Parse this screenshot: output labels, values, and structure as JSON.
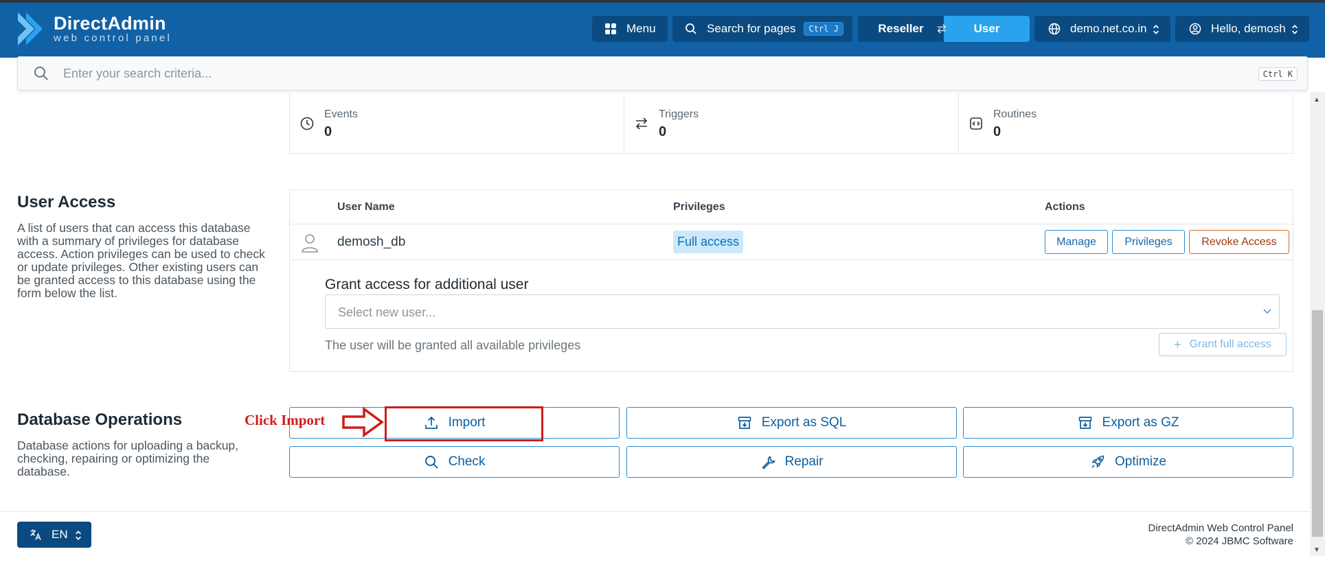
{
  "header": {
    "logo_title": "DirectAdmin",
    "logo_subtitle": "web control panel",
    "menu_label": "Menu",
    "search_label": "Search for pages",
    "search_shortcut": "Ctrl J",
    "role_reseller": "Reseller",
    "role_user": "User",
    "domain": "demo.net.co.in",
    "greeting": "Hello, demosh"
  },
  "search": {
    "placeholder": "Enter your search criteria...",
    "shortcut": "Ctrl K"
  },
  "stats": [
    {
      "label": "Events",
      "value": "0"
    },
    {
      "label": "Triggers",
      "value": "0"
    },
    {
      "label": "Routines",
      "value": "0"
    }
  ],
  "user_access": {
    "title": "User Access",
    "description": "A list of users that can access this database with a summary of privileges for database access. Action privileges can be used to check or update privileges. Other existing users can be granted access to this database using the form below the list.",
    "columns": {
      "user_name": "User Name",
      "privileges": "Privileges",
      "actions": "Actions"
    },
    "rows": [
      {
        "user": "demosh_db",
        "privilege": "Full access",
        "actions": [
          "Manage",
          "Privileges",
          "Revoke Access"
        ]
      }
    ],
    "grant_title": "Grant access for additional user",
    "select_placeholder": "Select new user...",
    "grant_note": "The user will be granted all available privileges",
    "grant_button": "Grant full access"
  },
  "db_ops": {
    "title": "Database Operations",
    "description": "Database actions for uploading a backup, checking, repairing or optimizing the database.",
    "buttons": [
      "Import",
      "Export as SQL",
      "Export as GZ",
      "Check",
      "Repair",
      "Optimize"
    ]
  },
  "annotation": {
    "text": "Click Import",
    "color": "#d11b1b"
  },
  "footer": {
    "language": "EN",
    "product": "DirectAdmin Web Control Panel",
    "copyright": "© 2024 JBMC Software"
  },
  "colors": {
    "header_bg": "#1161a6",
    "header_button_bg": "#0b4a80",
    "active_role": "#2aa3ee",
    "primary_outline": "#2a8bd0",
    "revoke_outline": "#d2691e"
  }
}
